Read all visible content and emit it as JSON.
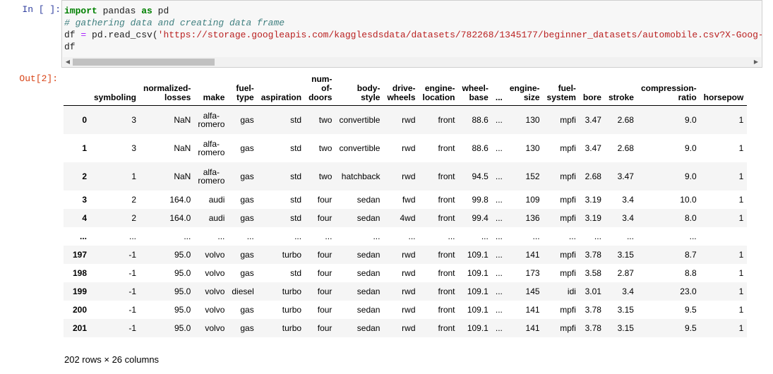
{
  "input_cell": {
    "prompt": "In [ ]:",
    "line1_kw1": "import",
    "line1_mod": " pandas ",
    "line1_kw2": "as",
    "line1_alias": " pd",
    "line2_comment": "# gathering data and creating data frame",
    "line3_lhs": "df ",
    "line3_eq": "=",
    "line3_call": " pd.read_csv(",
    "line3_str": "'https://storage.googleapis.com/kagglesdsdata/datasets/782268/1345177/beginner_datasets/automobile.csv?X-Goog-Al",
    "line4": "df"
  },
  "output_cell": {
    "prompt": "Out[2]:",
    "columns": [
      [
        "symboling"
      ],
      [
        "normalized-",
        "losses"
      ],
      [
        "make"
      ],
      [
        "fuel-",
        "type"
      ],
      [
        "aspiration"
      ],
      [
        "num-",
        "of-",
        "doors"
      ],
      [
        "body-",
        "style"
      ],
      [
        "drive-",
        "wheels"
      ],
      [
        "engine-",
        "location"
      ],
      [
        "wheel-",
        "base"
      ],
      [
        "..."
      ],
      [
        "engine-",
        "size"
      ],
      [
        "fuel-",
        "system"
      ],
      [
        "bore"
      ],
      [
        "stroke"
      ],
      [
        "compression-",
        "ratio"
      ],
      [
        "horsepow"
      ]
    ],
    "rows": [
      {
        "index": "0",
        "tall": true,
        "cells": [
          "3",
          "NaN",
          [
            "alfa-",
            "romero"
          ],
          "gas",
          "std",
          "two",
          "convertible",
          "rwd",
          "front",
          "88.6",
          "...",
          "130",
          "mpfi",
          "3.47",
          "2.68",
          "9.0",
          "1"
        ]
      },
      {
        "index": "1",
        "tall": true,
        "cells": [
          "3",
          "NaN",
          [
            "alfa-",
            "romero"
          ],
          "gas",
          "std",
          "two",
          "convertible",
          "rwd",
          "front",
          "88.6",
          "...",
          "130",
          "mpfi",
          "3.47",
          "2.68",
          "9.0",
          "1"
        ]
      },
      {
        "index": "2",
        "tall": true,
        "cells": [
          "1",
          "NaN",
          [
            "alfa-",
            "romero"
          ],
          "gas",
          "std",
          "two",
          "hatchback",
          "rwd",
          "front",
          "94.5",
          "...",
          "152",
          "mpfi",
          "2.68",
          "3.47",
          "9.0",
          "1"
        ]
      },
      {
        "index": "3",
        "tall": false,
        "cells": [
          "2",
          "164.0",
          "audi",
          "gas",
          "std",
          "four",
          "sedan",
          "fwd",
          "front",
          "99.8",
          "...",
          "109",
          "mpfi",
          "3.19",
          "3.4",
          "10.0",
          "1"
        ]
      },
      {
        "index": "4",
        "tall": false,
        "cells": [
          "2",
          "164.0",
          "audi",
          "gas",
          "std",
          "four",
          "sedan",
          "4wd",
          "front",
          "99.4",
          "...",
          "136",
          "mpfi",
          "3.19",
          "3.4",
          "8.0",
          "1"
        ]
      },
      {
        "index": "...",
        "tall": false,
        "cells": [
          "...",
          "...",
          "...",
          "...",
          "...",
          "...",
          "...",
          "...",
          "...",
          "...",
          "...",
          "...",
          "...",
          "...",
          "...",
          "...",
          ""
        ]
      },
      {
        "index": "197",
        "tall": false,
        "cells": [
          "-1",
          "95.0",
          "volvo",
          "gas",
          "turbo",
          "four",
          "sedan",
          "rwd",
          "front",
          "109.1",
          "...",
          "141",
          "mpfi",
          "3.78",
          "3.15",
          "8.7",
          "1"
        ]
      },
      {
        "index": "198",
        "tall": false,
        "cells": [
          "-1",
          "95.0",
          "volvo",
          "gas",
          "std",
          "four",
          "sedan",
          "rwd",
          "front",
          "109.1",
          "...",
          "173",
          "mpfi",
          "3.58",
          "2.87",
          "8.8",
          "1"
        ]
      },
      {
        "index": "199",
        "tall": false,
        "cells": [
          "-1",
          "95.0",
          "volvo",
          "diesel",
          "turbo",
          "four",
          "sedan",
          "rwd",
          "front",
          "109.1",
          "...",
          "145",
          "idi",
          "3.01",
          "3.4",
          "23.0",
          "1"
        ]
      },
      {
        "index": "200",
        "tall": false,
        "cells": [
          "-1",
          "95.0",
          "volvo",
          "gas",
          "turbo",
          "four",
          "sedan",
          "rwd",
          "front",
          "109.1",
          "...",
          "141",
          "mpfi",
          "3.78",
          "3.15",
          "9.5",
          "1"
        ]
      },
      {
        "index": "201",
        "tall": false,
        "cells": [
          "-1",
          "95.0",
          "volvo",
          "gas",
          "turbo",
          "four",
          "sedan",
          "rwd",
          "front",
          "109.1",
          "...",
          "141",
          "mpfi",
          "3.78",
          "3.15",
          "9.5",
          "1"
        ]
      }
    ],
    "footer": "202 rows × 26 columns"
  },
  "scrollbar": {
    "left_icon": "scroll-left-arrow-icon",
    "right_icon": "scroll-right-arrow-icon"
  }
}
